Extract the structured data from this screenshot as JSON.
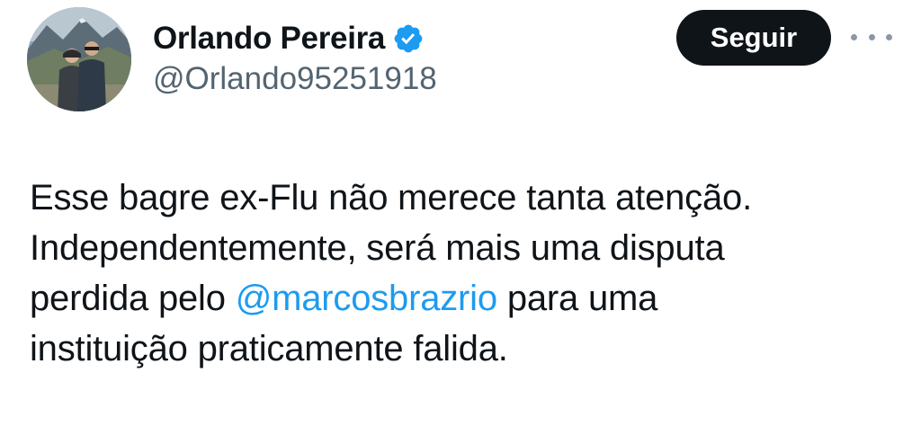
{
  "author": {
    "display_name": "Orlando Pereira",
    "handle": "@Orlando95251918",
    "verified": true,
    "verified_badge_color": "#1d9bf0"
  },
  "actions": {
    "follow_label": "Seguir",
    "more_icon": "more-horizontal-icon"
  },
  "tweet": {
    "line1": "Esse bagre ex-Flu não merece tanta atenção.",
    "line2": "Independentemente, será mais uma disputa",
    "line3_before": "perdida pelo ",
    "mention": "@marcosbrazrio",
    "line3_after": " para uma",
    "line4": "instituição praticamente falida."
  },
  "colors": {
    "text": "#0f1419",
    "secondary": "#536471",
    "link": "#1d9bf0",
    "button_bg": "#0f1419",
    "button_text": "#ffffff"
  }
}
